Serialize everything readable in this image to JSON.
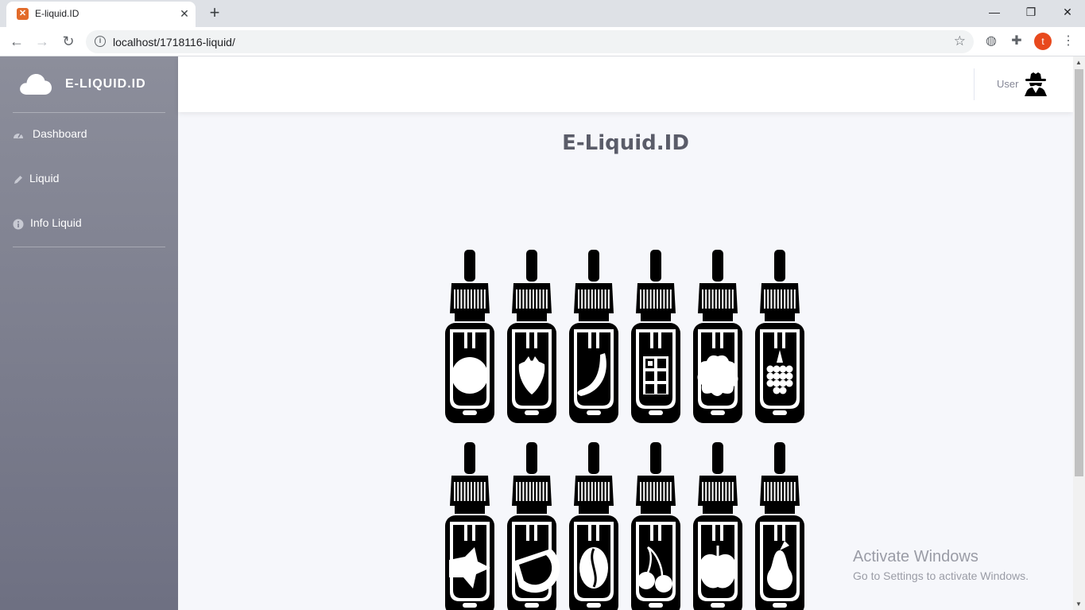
{
  "browser": {
    "tab_title": "E-liquid.ID",
    "tab_close": "✕",
    "new_tab": "+",
    "url": "localhost/1718116-liquid/",
    "profile_initial": "t",
    "window_controls": {
      "minimize": "—",
      "maximize": "❐",
      "close": "✕"
    }
  },
  "sidebar": {
    "brand": "E-LIQUID.ID",
    "items": [
      {
        "label": "Dashboard",
        "icon": "tachometer-icon"
      },
      {
        "label": "Liquid",
        "icon": "pencil-icon"
      },
      {
        "label": "Info Liquid",
        "icon": "info-circle-icon"
      }
    ]
  },
  "topbar": {
    "user_label": "User",
    "avatar_icon": "user-secret-icon"
  },
  "main": {
    "title": "E-Liquid.ID",
    "illustration": {
      "name": "e-liquid-bottles-illustration",
      "rows": [
        [
          "circle",
          "strawberry",
          "banana",
          "chocolate",
          "cookie",
          "raspberry"
        ],
        [
          "star-fruit",
          "watermelon",
          "coffee-bean",
          "cherry",
          "apple",
          "pear"
        ]
      ]
    }
  },
  "watermark": {
    "title": "Activate Windows",
    "subtitle": "Go to Settings to activate Windows."
  },
  "colors": {
    "sidebar_top": "#8c8e9b",
    "sidebar_bottom": "#6e7082",
    "page_bg": "#f6f7fb",
    "title": "#5a5c69",
    "profile": "#e8491d"
  }
}
